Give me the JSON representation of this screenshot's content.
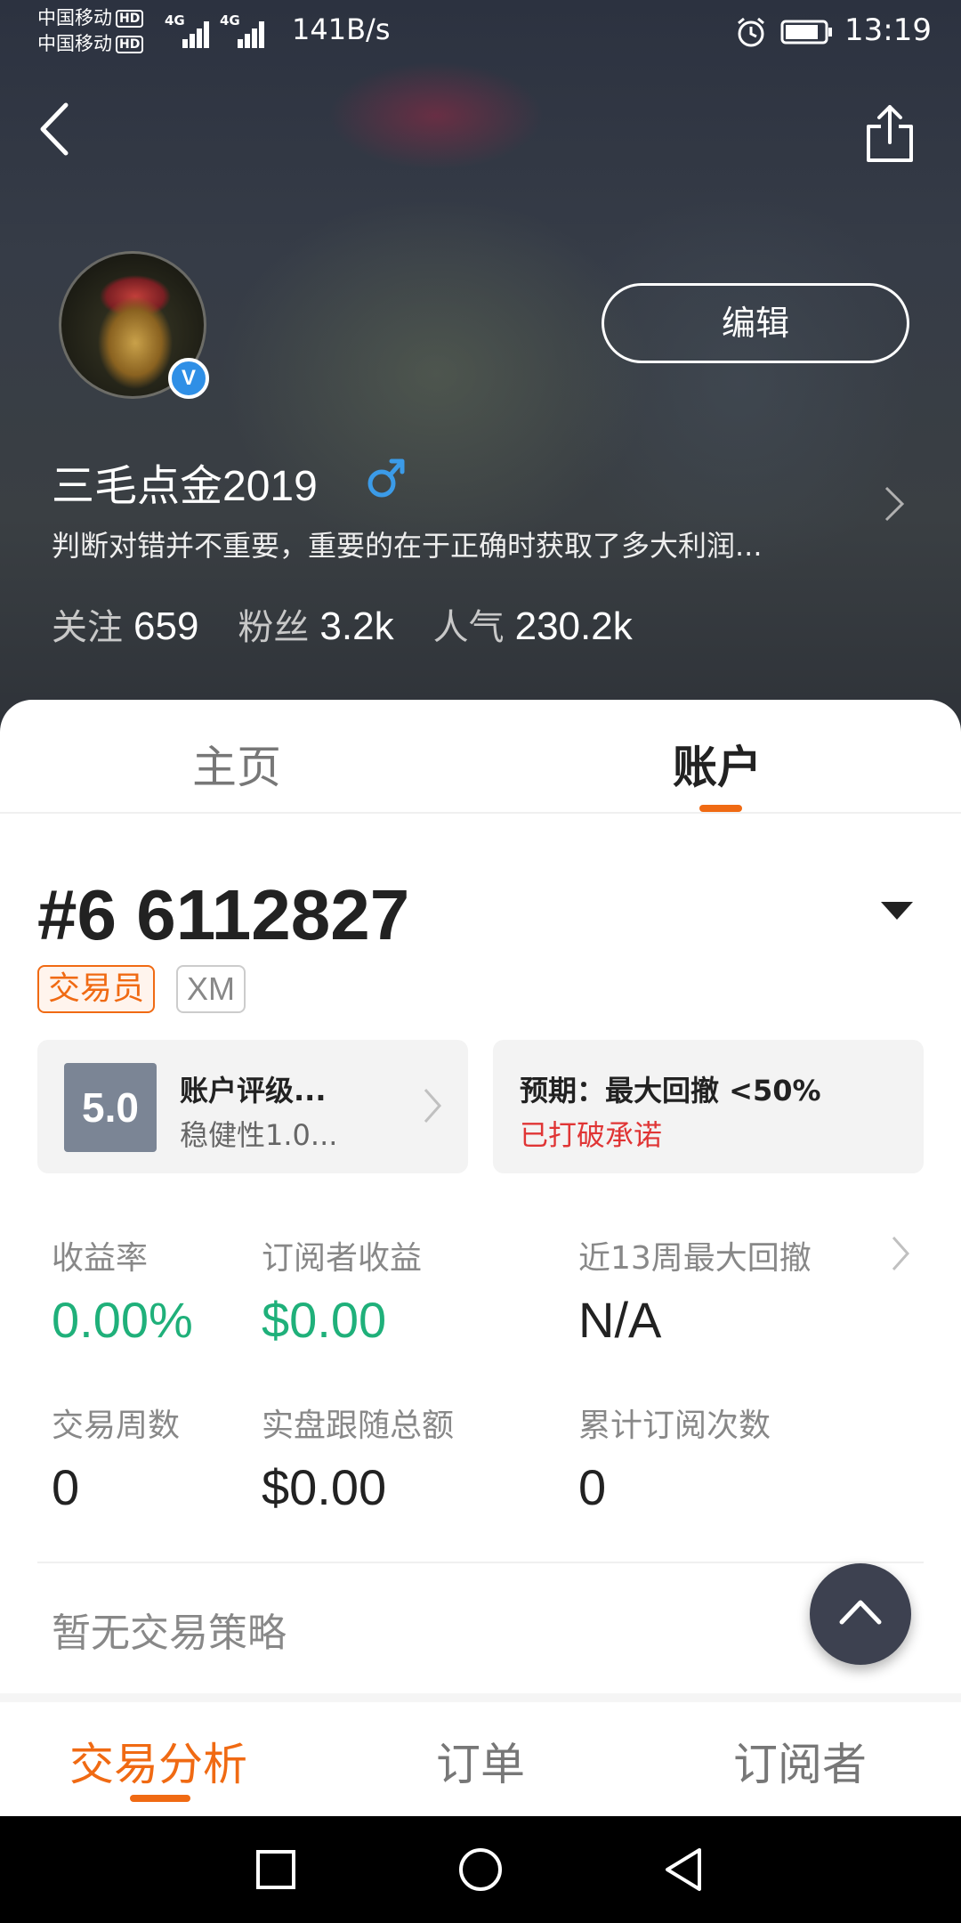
{
  "status_bar": {
    "carrier_1": "中国移动",
    "carrier_2": "中国移动",
    "hd_badge": "HD",
    "network_1": "4G",
    "network_2": "4G",
    "net_speed": "141B/s",
    "time": "13:19",
    "icons": [
      "alarm-icon",
      "battery-icon",
      "signal-icon"
    ]
  },
  "profile": {
    "username": "三毛点金2019",
    "gender_symbol": "♂",
    "bio": "判断对错并不重要，重要的在于正确时获取了多大利润...",
    "verified_mark": "V",
    "edit_label": "编辑",
    "stats": [
      {
        "label": "关注",
        "value": "659"
      },
      {
        "label": "粉丝",
        "value": "3.2k"
      },
      {
        "label": "人气",
        "value": "230.2k"
      }
    ]
  },
  "tabs_top": {
    "home": "主页",
    "account": "账户",
    "active": "account"
  },
  "account": {
    "number": "#6 6112827",
    "tags": {
      "trader": "交易员",
      "broker": "XM"
    },
    "rating": {
      "score": "5.0",
      "title": "账户评级...",
      "subtitle": "稳健性1.0..."
    },
    "expectation": {
      "title": "预期：最大回撤 <50%",
      "status": "已打破承诺"
    },
    "metrics": [
      {
        "label": "收益率",
        "value": "0.00%"
      },
      {
        "label": "订阅者收益",
        "value": "$0.00"
      },
      {
        "label": "近13周最大回撤",
        "value": "N/A"
      },
      {
        "label": "交易周数",
        "value": "0"
      },
      {
        "label": "实盘跟随总额",
        "value": "$0.00"
      },
      {
        "label": "累计订阅次数",
        "value": "0"
      }
    ],
    "no_strategy": "暂无交易策略"
  },
  "bottom_tabs": {
    "analysis": "交易分析",
    "orders": "订单",
    "subscribers": "订阅者",
    "active": "analysis"
  },
  "colors": {
    "accent": "#f06a13",
    "positive": "#1fb07a",
    "warning": "#e03535",
    "header_bg": "#343a44"
  }
}
